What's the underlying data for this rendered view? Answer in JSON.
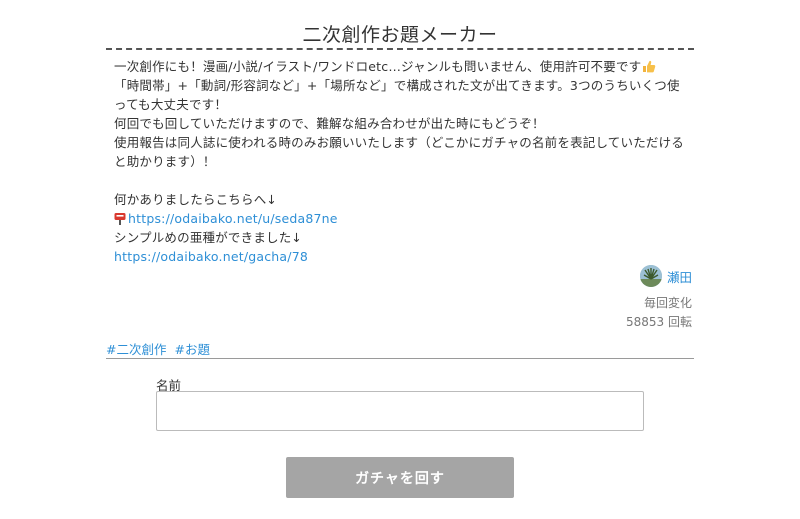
{
  "header": {
    "title": "二次創作お題メーカー"
  },
  "description": {
    "line1": "一次創作にも！漫画/小説/イラスト/ワンドロetc…ジャンルも問いません、使用許可不要です",
    "thumb_icon": "thumbs-up-icon",
    "line2": "「時間帯」+「動詞/形容詞など」+「場所など」で構成された文が出てきます。3つのうちいくつ使っても大丈夫です！",
    "line3": "何回でも回していただけますので、難解な組み合わせが出た時にもどうぞ！",
    "line4": "使用報告は同人誌に使われる時のみお願いいたします（どこかにガチャの名前を表記していただけると助かります）！",
    "line5": "何かありましたらこちらへ↓",
    "mailbox_icon": "mailbox-icon",
    "link1": "https://odaibako.net/u/seda87ne",
    "line6": "シンプルめの亜種ができました↓",
    "link2": "https://odaibako.net/gacha/78"
  },
  "author": {
    "name": "瀬田",
    "avatar_icon": "avatar"
  },
  "stats": {
    "change": "毎回変化",
    "count": "58853 回転"
  },
  "tags": [
    "#二次創作",
    "#お題"
  ],
  "form": {
    "name_label": "名前",
    "name_value": "",
    "name_placeholder": ""
  },
  "button": {
    "label": "ガチャを回す",
    "color": "#a5a5a5"
  },
  "colors": {
    "link": "#2e8fd6",
    "text": "#333333",
    "muted": "#777777"
  }
}
